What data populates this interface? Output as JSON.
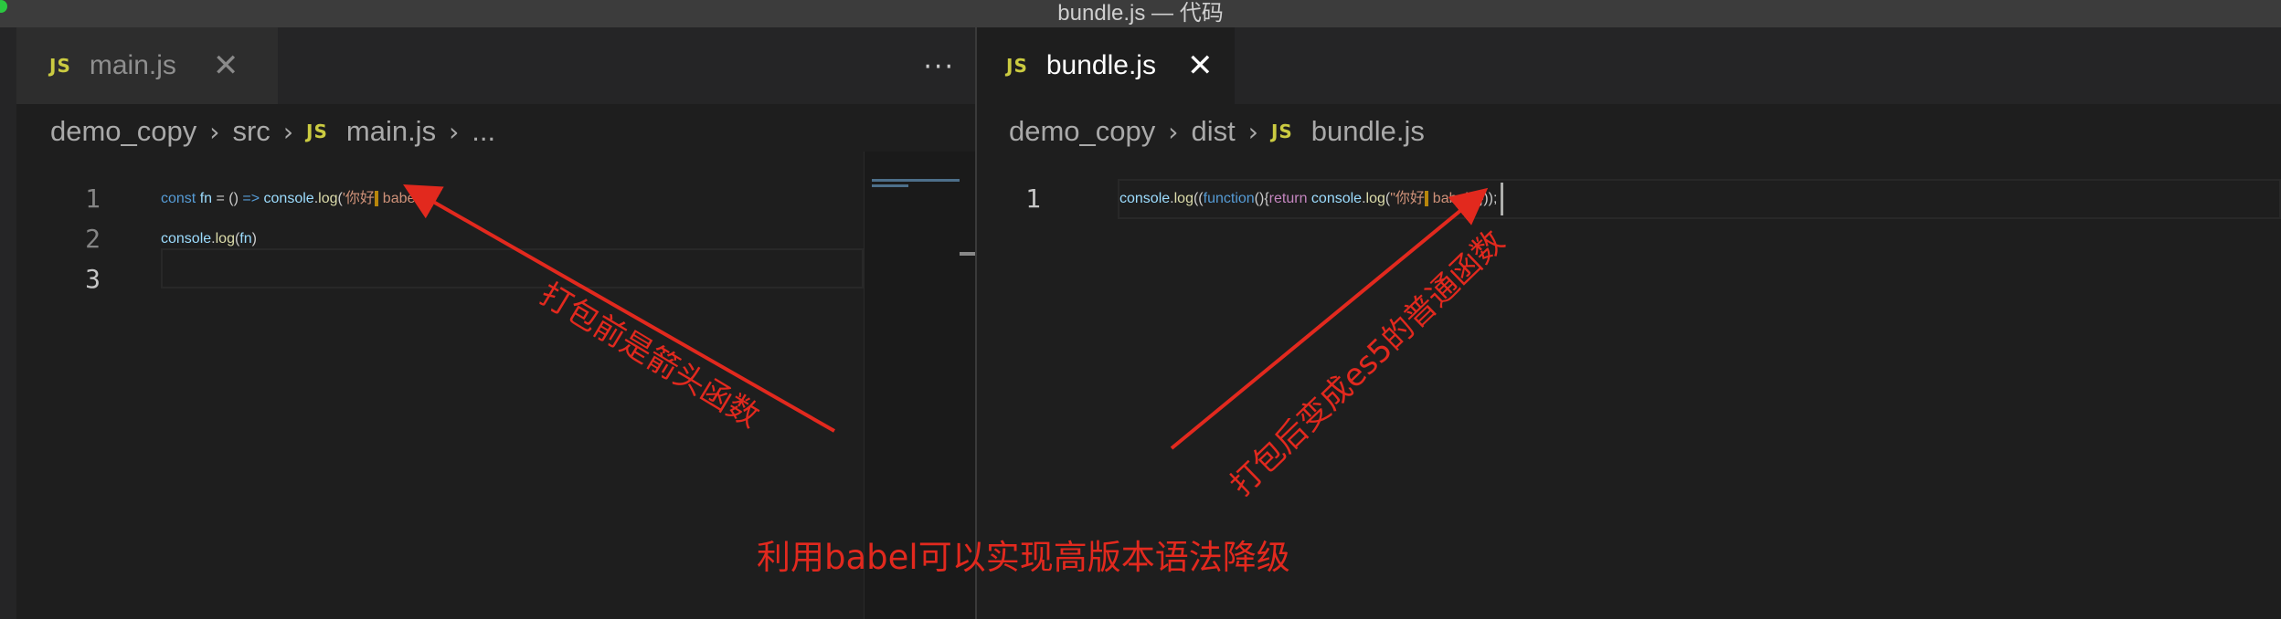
{
  "window": {
    "title": "bundle.js — 代码"
  },
  "left_pane": {
    "tab": {
      "icon": "js-file-icon",
      "badge": "JS",
      "label": "main.js",
      "close_glyph": "✕"
    },
    "more_actions": "···",
    "breadcrumb": {
      "folder": "demo_copy",
      "subfolder": "src",
      "badge": "JS",
      "file": "main.js",
      "ellipsis": "..."
    },
    "lines": [
      {
        "number": "1",
        "code": "const fn = () => console.log('你好! babel')"
      },
      {
        "number": "2",
        "code": "console.log(fn)"
      },
      {
        "number": "3",
        "code": ""
      }
    ]
  },
  "right_pane": {
    "tab": {
      "icon": "js-file-icon",
      "badge": "JS",
      "label": "bundle.js",
      "close_glyph": "✕"
    },
    "breadcrumb": {
      "folder": "demo_copy",
      "subfolder": "dist",
      "badge": "JS",
      "file": "bundle.js"
    },
    "lines": [
      {
        "number": "1",
        "code": "console.log((function(){return console.log(\"你好! babel\")}));"
      }
    ]
  },
  "annotations": {
    "left_arrow_text": "打包前是箭头函数",
    "right_arrow_text": "打包后变成es5的普通函数",
    "bottom_text": "利用babel可以实现高版本语法降级",
    "color": "#e2291e"
  },
  "colors": {
    "editor_background": "#1e1e1e",
    "keyword": "#569cd6",
    "control_keyword": "#c586c0",
    "variable": "#9cdcfe",
    "function": "#dcdcaa",
    "string": "#ce9178",
    "js_badge": "#cbcb41"
  }
}
